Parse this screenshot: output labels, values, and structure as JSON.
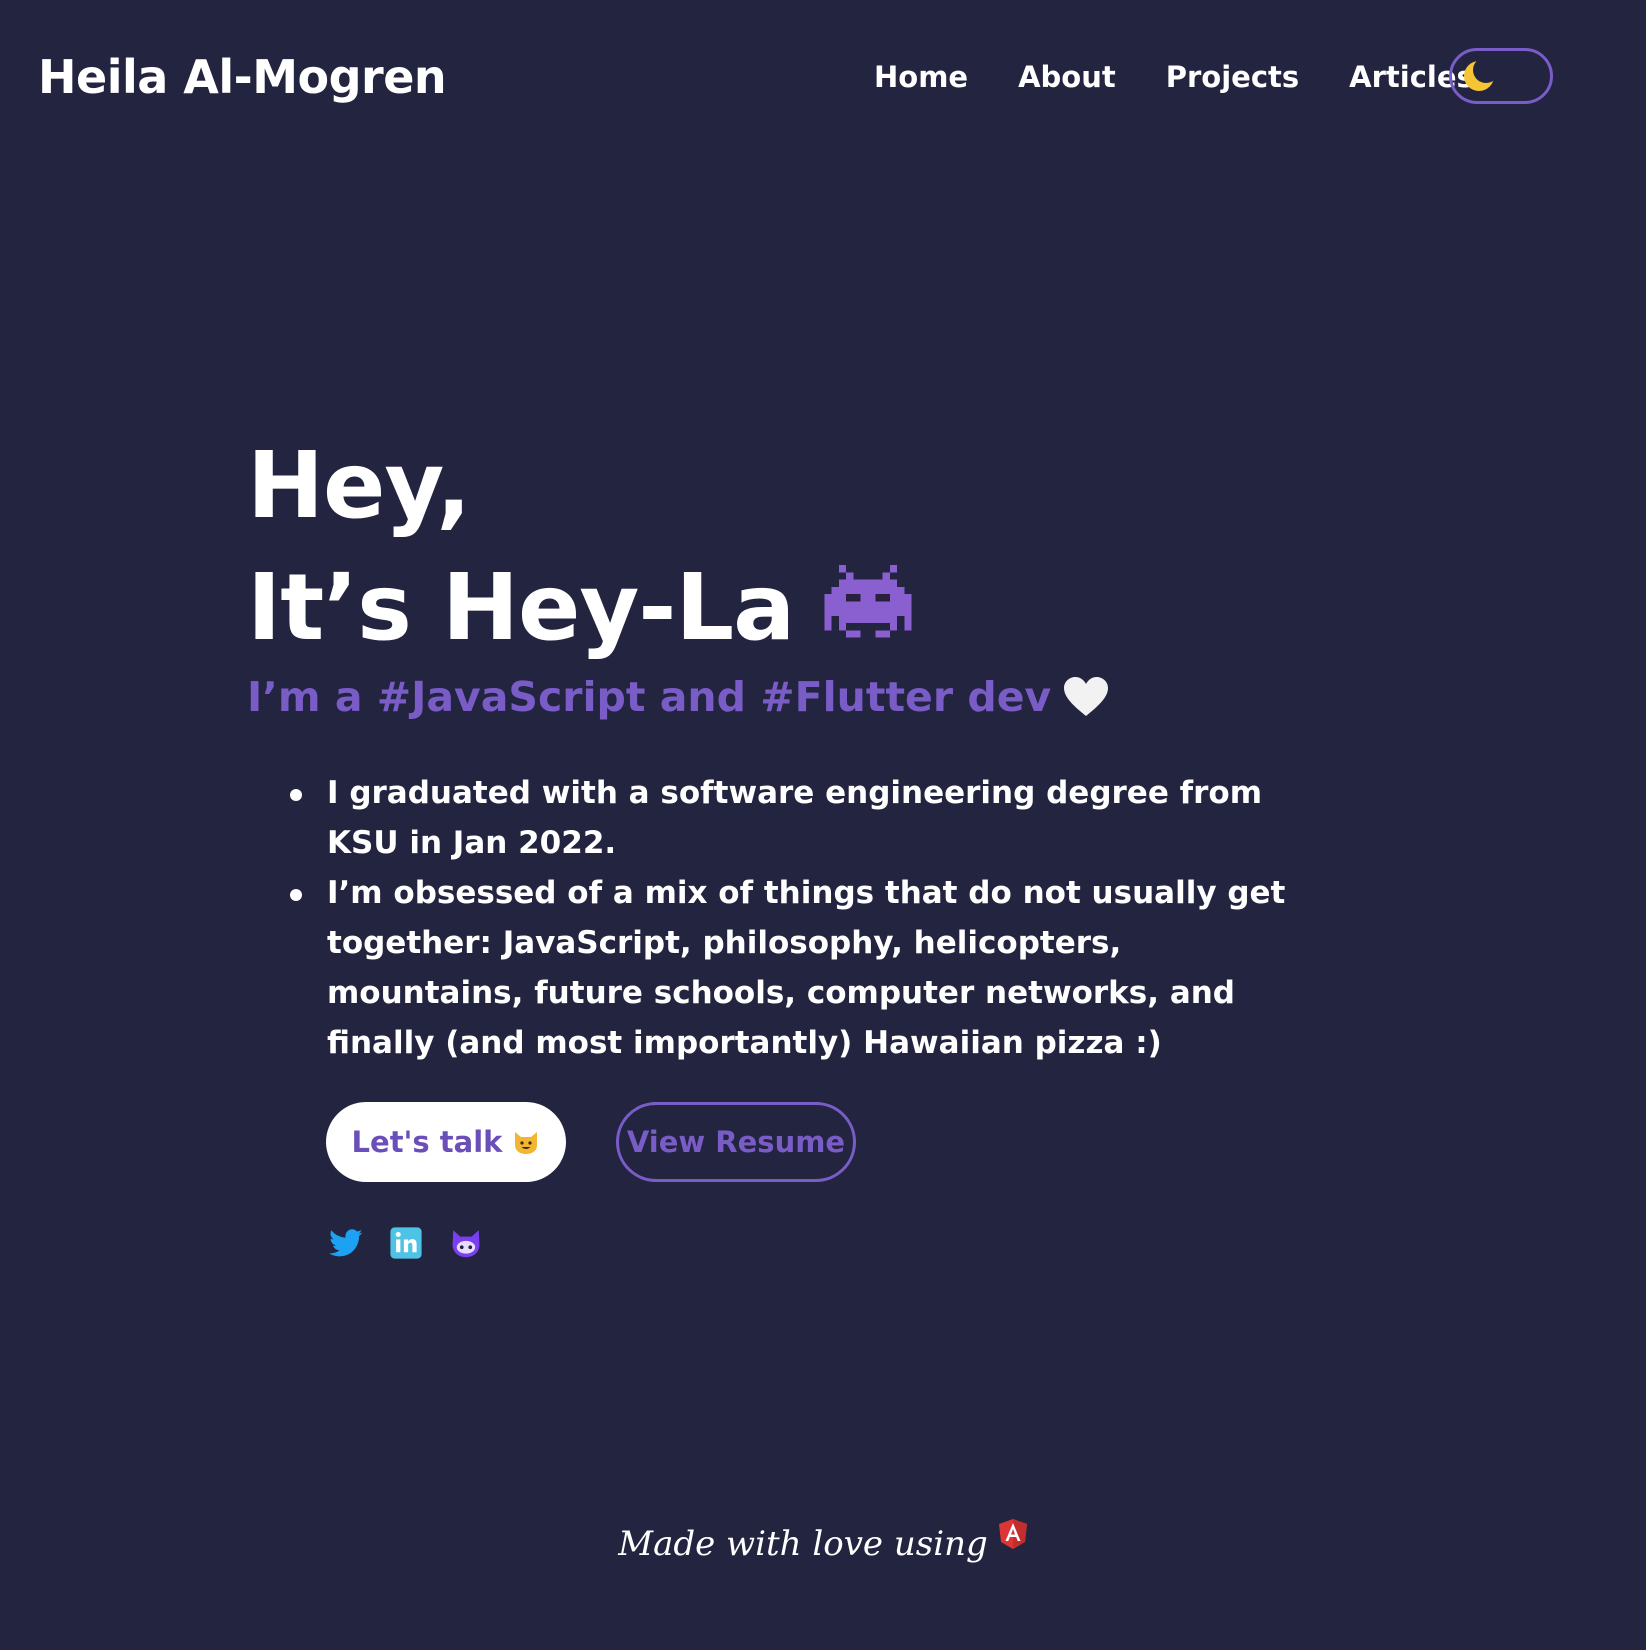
{
  "header": {
    "site_name": "Heila Al-Mogren",
    "nav": [
      "Home",
      "About",
      "Projects",
      "Articles"
    ],
    "theme_toggle_icon": "moon-icon"
  },
  "hero": {
    "greeting_line1": "Hey,",
    "greeting_line2": "It’s Hey-La",
    "greeting_icon": "alien-monster-icon",
    "tagline": "I’m a #JavaScript and #Flutter dev",
    "tagline_icon": "white-heart-icon",
    "bullets": [
      "I graduated with a software engineering degree from KSU in Jan 2022.",
      "I’m obsessed of a mix of things that do not usually get together: JavaScript, philosophy, helicopters, mountains, future schools, computer networks, and finally (and most importantly) Hawaiian pizza :)"
    ]
  },
  "actions": {
    "primary_label": "Let's talk",
    "primary_icon": "smiling-cat-icon",
    "secondary_label": "View Resume"
  },
  "social_links": [
    "twitter-icon",
    "linkedin-icon",
    "github-icon"
  ],
  "footer": {
    "text": "Made with love using",
    "icon": "angular-icon"
  },
  "colors": {
    "background": "#222440",
    "accent": "#7a5cc7",
    "text": "#ffffff",
    "twitter": "#1da1f2",
    "linkedin": "#4fc3e6",
    "angular": "#dd3535"
  }
}
